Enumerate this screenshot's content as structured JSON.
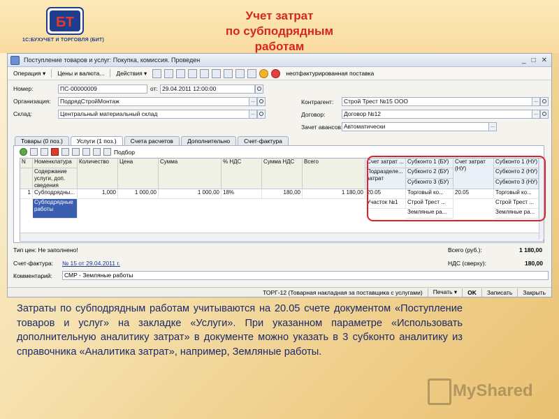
{
  "slide": {
    "logo_text": "1С:БУХУЧЕТ И ТОРГОВЛЯ (БИТ)",
    "logo_mark": "БТ",
    "title_line1": "Учет затрат",
    "title_line2": "по субподрядным работам",
    "description": "Затраты по субподрядным работам учитываются на 20.05 счете документом «Поступление товаров и услуг» на закладке «Услуги». При указанном параметре «Использовать дополнительную аналитику затрат» в документе можно указать в 3 субконто аналитику из справочника «Аналитика затрат», например, Земляные работы.",
    "watermark": "MyShared"
  },
  "window": {
    "title": "Поступление товаров и услуг: Покупка, комиссия. Проведен",
    "toolbar": {
      "operation": "Операция ▾",
      "prices": "Цены и валюта...",
      "actions": "Действия ▾",
      "unbilled": "неотфактурированная поставка"
    }
  },
  "form": {
    "number_label": "Номер:",
    "number_value": "ПС-00000009",
    "from_label": "от:",
    "date_value": "29.04.2011 12:00:00",
    "org_label": "Организация:",
    "org_value": "ПодрядСтройМонтаж",
    "warehouse_label": "Склад:",
    "warehouse_value": "Центральный материальный склад",
    "counterparty_label": "Контрагент:",
    "counterparty_value": "Строй Трест №15 ООО",
    "contract_label": "Договор:",
    "contract_value": "Договор №12",
    "advance_label": "Зачет авансов:",
    "advance_value": "Автоматически"
  },
  "tabs": [
    {
      "label": "Товары (0 поз.)"
    },
    {
      "label": "Услуги (1 поз.)"
    },
    {
      "label": "Счета расчетов"
    },
    {
      "label": "Дополнительно"
    },
    {
      "label": "Счет-фактура"
    }
  ],
  "grid": {
    "tool_select": "Подбор",
    "headers": {
      "n": "N",
      "nomenclature": "Номенклатура",
      "content": "Содержание услуги, доп. сведения",
      "qty": "Количество",
      "price": "Цена",
      "sum": "Сумма",
      "vat_rate": "% НДС",
      "vat_sum": "Сумма НДС",
      "total": "Всего",
      "cost_account": "Счет затрат ...",
      "division": "Подразделе... затрат",
      "sub1_bu": "Субконто 1 (БУ)",
      "sub2_bu": "Субконто 2 (БУ)",
      "sub3_bu": "Субконто 3 (БУ)",
      "cost_account_nu": "Счет затрат (НУ)",
      "sub1_nu": "Субконто 1 (НУ)",
      "sub2_nu": "Субконто 2 (НУ)",
      "sub3_nu": "Субконто 3 (НУ)"
    },
    "row": {
      "n": "1",
      "nomenclature": "Субподрядны...",
      "content": "Субподрядные работы",
      "qty": "1,000",
      "price": "1 000,00",
      "sum": "1 000,00",
      "vat_rate": "18%",
      "vat_sum": "180,00",
      "total": "1 180,00",
      "cost_account": "20.05",
      "division": "Участок №1",
      "sub1_bu": "Торговый ко...",
      "sub2_bu": "Строй Трест ...",
      "sub3_bu": "Земляные ра...",
      "cost_account_nu": "20.05",
      "sub1_nu": "Торговый ко...",
      "sub2_nu": "Строй Трест ...",
      "sub3_nu": "Земляные ра..."
    }
  },
  "footer": {
    "price_type": "Тип цен: Не заполнено!",
    "total_label": "Всего (руб.):",
    "total_value": "1 180,00",
    "invoice_label": "Счет-фактура:",
    "invoice_value": "№ 15 от 29.04.2011 г.",
    "vat_label": "НДС (сверху):",
    "vat_value": "180,00",
    "comment_label": "Комментарий:",
    "comment_value": "СМР - Земляные работы"
  },
  "statusbar": {
    "torg": "ТОРГ-12 (Товарная накладная за поставщика с услугами)",
    "print": "Печать ▾",
    "ok": "OK",
    "save": "Записать",
    "close": "Закрыть"
  }
}
